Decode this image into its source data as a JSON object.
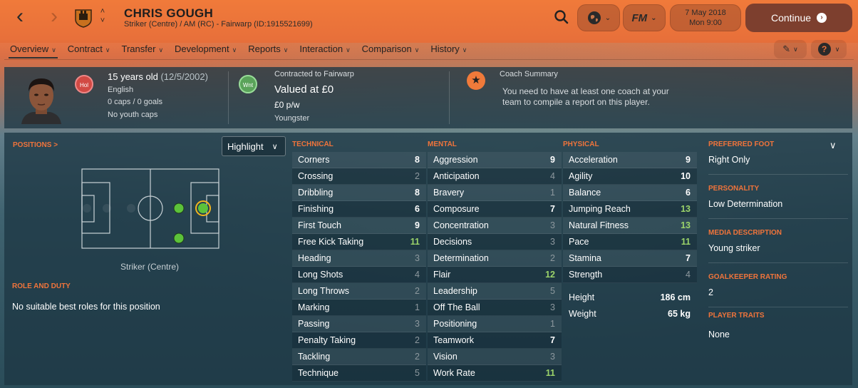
{
  "header": {
    "player_name": "CHRIS GOUGH",
    "player_subtitle": "Striker (Centre) / AM (RC) - Fairwarp (ID:1915521699)",
    "date_line1": "7 May 2018",
    "date_line2": "Mon 9:00",
    "fm_label": "FM",
    "continue_label": "Continue"
  },
  "tabs": [
    {
      "label": "Overview"
    },
    {
      "label": "Contract"
    },
    {
      "label": "Transfer"
    },
    {
      "label": "Development"
    },
    {
      "label": "Reports"
    },
    {
      "label": "Interaction"
    },
    {
      "label": "Comparison"
    },
    {
      "label": "History"
    }
  ],
  "summary": {
    "age": "15 years old",
    "dob": "(12/5/2002)",
    "nationality": "English",
    "caps": "0 caps / 0 goals",
    "youth_caps": "No youth caps",
    "badge_hol": "Hol",
    "badge_wnt": "Wnt",
    "contract_label": "Contracted to Fairwarp",
    "value": "Valued at £0",
    "wage": "£0 p/w",
    "contract_type": "Youngster",
    "coach_title": "Coach Summary",
    "coach_text_1": "You need to have at least one coach at your",
    "coach_text_2": "team to compile a report on this player."
  },
  "positions": {
    "title": "POSITIONS >",
    "highlight_label": "Highlight",
    "position_name": "Striker (Centre)",
    "role_title": "ROLE AND DUTY",
    "role_text": "No suitable best roles for this position"
  },
  "technical": {
    "title": "TECHNICAL",
    "attrs": [
      {
        "name": "Corners",
        "value": "8",
        "tier": "high"
      },
      {
        "name": "Crossing",
        "value": "2",
        "tier": "low"
      },
      {
        "name": "Dribbling",
        "value": "8",
        "tier": "high"
      },
      {
        "name": "Finishing",
        "value": "6",
        "tier": "high"
      },
      {
        "name": "First Touch",
        "value": "9",
        "tier": "high"
      },
      {
        "name": "Free Kick Taking",
        "value": "11",
        "tier": "good"
      },
      {
        "name": "Heading",
        "value": "3",
        "tier": "low"
      },
      {
        "name": "Long Shots",
        "value": "4",
        "tier": "low"
      },
      {
        "name": "Long Throws",
        "value": "2",
        "tier": "low"
      },
      {
        "name": "Marking",
        "value": "1",
        "tier": "low"
      },
      {
        "name": "Passing",
        "value": "3",
        "tier": "low"
      },
      {
        "name": "Penalty Taking",
        "value": "2",
        "tier": "low"
      },
      {
        "name": "Tackling",
        "value": "2",
        "tier": "low"
      },
      {
        "name": "Technique",
        "value": "5",
        "tier": "low"
      }
    ]
  },
  "mental": {
    "title": "MENTAL",
    "attrs": [
      {
        "name": "Aggression",
        "value": "9",
        "tier": "high"
      },
      {
        "name": "Anticipation",
        "value": "4",
        "tier": "low"
      },
      {
        "name": "Bravery",
        "value": "1",
        "tier": "low"
      },
      {
        "name": "Composure",
        "value": "7",
        "tier": "high"
      },
      {
        "name": "Concentration",
        "value": "3",
        "tier": "low"
      },
      {
        "name": "Decisions",
        "value": "3",
        "tier": "low"
      },
      {
        "name": "Determination",
        "value": "2",
        "tier": "low"
      },
      {
        "name": "Flair",
        "value": "12",
        "tier": "good"
      },
      {
        "name": "Leadership",
        "value": "5",
        "tier": "low"
      },
      {
        "name": "Off The Ball",
        "value": "3",
        "tier": "low"
      },
      {
        "name": "Positioning",
        "value": "1",
        "tier": "low"
      },
      {
        "name": "Teamwork",
        "value": "7",
        "tier": "high"
      },
      {
        "name": "Vision",
        "value": "3",
        "tier": "low"
      },
      {
        "name": "Work Rate",
        "value": "11",
        "tier": "good"
      }
    ]
  },
  "physical": {
    "title": "PHYSICAL",
    "attrs": [
      {
        "name": "Acceleration",
        "value": "9",
        "tier": "high"
      },
      {
        "name": "Agility",
        "value": "10",
        "tier": "high"
      },
      {
        "name": "Balance",
        "value": "6",
        "tier": "high"
      },
      {
        "name": "Jumping Reach",
        "value": "13",
        "tier": "good"
      },
      {
        "name": "Natural Fitness",
        "value": "13",
        "tier": "good"
      },
      {
        "name": "Pace",
        "value": "11",
        "tier": "good"
      },
      {
        "name": "Stamina",
        "value": "7",
        "tier": "high"
      },
      {
        "name": "Strength",
        "value": "4",
        "tier": "low"
      }
    ],
    "height_label": "Height",
    "height_value": "186 cm",
    "weight_label": "Weight",
    "weight_value": "65 kg"
  },
  "info": {
    "preferred_foot_label": "PREFERRED FOOT",
    "preferred_foot": "Right Only",
    "personality_label": "PERSONALITY",
    "personality": "Low Determination",
    "media_label": "MEDIA DESCRIPTION",
    "media": "Young striker",
    "gk_label": "GOALKEEPER RATING",
    "gk_rating": "2",
    "traits_label": "PLAYER TRAITS",
    "traits": "None"
  },
  "colors": {
    "accent": "#f0743b",
    "good": "#9bd36a",
    "continue_bg": "#7d3f2e"
  }
}
